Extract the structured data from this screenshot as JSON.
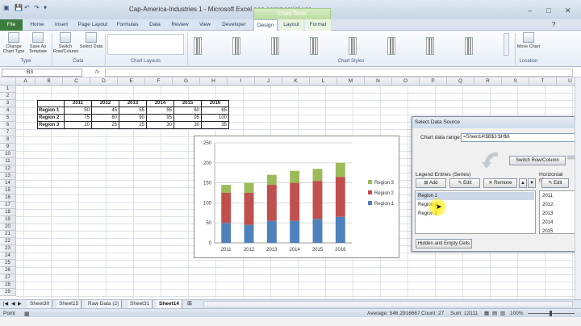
{
  "window": {
    "title": "Cap-America-Industries 1  -  Microsoft Excel non-commercial use",
    "chart_tools_label": "Chart Tools",
    "controls": [
      "–",
      "□",
      "✕"
    ]
  },
  "tabs": [
    "File",
    "Home",
    "Insert",
    "Page Layout",
    "Formulas",
    "Data",
    "Review",
    "View",
    "Developer",
    "Design",
    "Layout",
    "Format"
  ],
  "ribbon": {
    "buttons": {
      "change_chart_type": "Change Chart Type",
      "save_as_template": "Save As Template",
      "switch_row_column": "Switch Row/Column",
      "select_data": "Select Data",
      "move_chart": "Move Chart"
    },
    "groups": {
      "type": "Type",
      "data": "Data",
      "chart_layouts": "Chart Layouts",
      "chart_styles": "Chart Styles",
      "location": "Location"
    }
  },
  "formula_bar": {
    "name_box": "B3",
    "fx": "fx"
  },
  "grid": {
    "columns": [
      "A",
      "B",
      "C",
      "D",
      "E",
      "F",
      "G",
      "H",
      "I",
      "J",
      "K",
      "L",
      "M",
      "N",
      "O",
      "P",
      "Q",
      "R",
      "S",
      "T",
      "U"
    ],
    "rows": [
      "1",
      "2",
      "3",
      "4",
      "5",
      "6",
      "7",
      "8",
      "9",
      "10",
      "11",
      "12",
      "13",
      "14",
      "15",
      "16",
      "17",
      "18",
      "19",
      "20",
      "21",
      "22",
      "23",
      "24",
      "25",
      "26",
      "27",
      "28",
      "29"
    ],
    "table": {
      "headers": [
        "2011",
        "2012",
        "2013",
        "2014",
        "2015",
        "2016"
      ],
      "rows": [
        {
          "label": "Region 1",
          "values": [
            "50",
            "45",
            "55",
            "55",
            "60",
            "65"
          ]
        },
        {
          "label": "Region 2",
          "values": [
            "75",
            "80",
            "90",
            "95",
            "95",
            "100"
          ]
        },
        {
          "label": "Region 3",
          "values": [
            "20",
            "25",
            "25",
            "30",
            "30",
            "35"
          ]
        }
      ]
    }
  },
  "chart_data": {
    "type": "bar",
    "stacked": true,
    "categories": [
      "2011",
      "2012",
      "2013",
      "2014",
      "2015",
      "2016"
    ],
    "series": [
      {
        "name": "Region 1",
        "values": [
          50,
          45,
          55,
          55,
          60,
          65
        ],
        "color": "#4f81bd"
      },
      {
        "name": "Region 2",
        "values": [
          75,
          80,
          90,
          95,
          95,
          100
        ],
        "color": "#c0504d"
      },
      {
        "name": "Region 3",
        "values": [
          20,
          25,
          25,
          30,
          30,
          35
        ],
        "color": "#9bbb59"
      }
    ],
    "ylim": [
      0,
      250
    ],
    "yticks": [
      "0",
      "50",
      "100",
      "150",
      "200",
      "250"
    ],
    "grid": true,
    "legend": "right"
  },
  "dialog": {
    "title": "Select Data Source",
    "chart_data_range_label": "Chart data range:",
    "chart_data_range_value": "=Sheet14!$B$3:$H$6",
    "switch_button": "Switch Row/Column",
    "legend_entries_label": "Legend Entries (Series)",
    "add": "Add",
    "edit": "Edit",
    "remove": "Remove",
    "series": [
      "Region 1",
      "Region 2",
      "Region 3"
    ],
    "horizontal_label": "Horizontal (Category",
    "cat_edit": "Edit",
    "categories": [
      "2011",
      "2012",
      "2013",
      "2014",
      "2015"
    ],
    "hidden_cells_button": "Hidden and Empty Cells"
  },
  "sheet_tabs": [
    "Sheet30",
    "Sheet15",
    "Raw Data (2)",
    "Sheet31",
    "Sheet14"
  ],
  "status": {
    "mode": "Point",
    "average": "Average: 546.2916667",
    "count": "Count: 27",
    "sum": "Sum: 13111",
    "zoom": "100%"
  }
}
